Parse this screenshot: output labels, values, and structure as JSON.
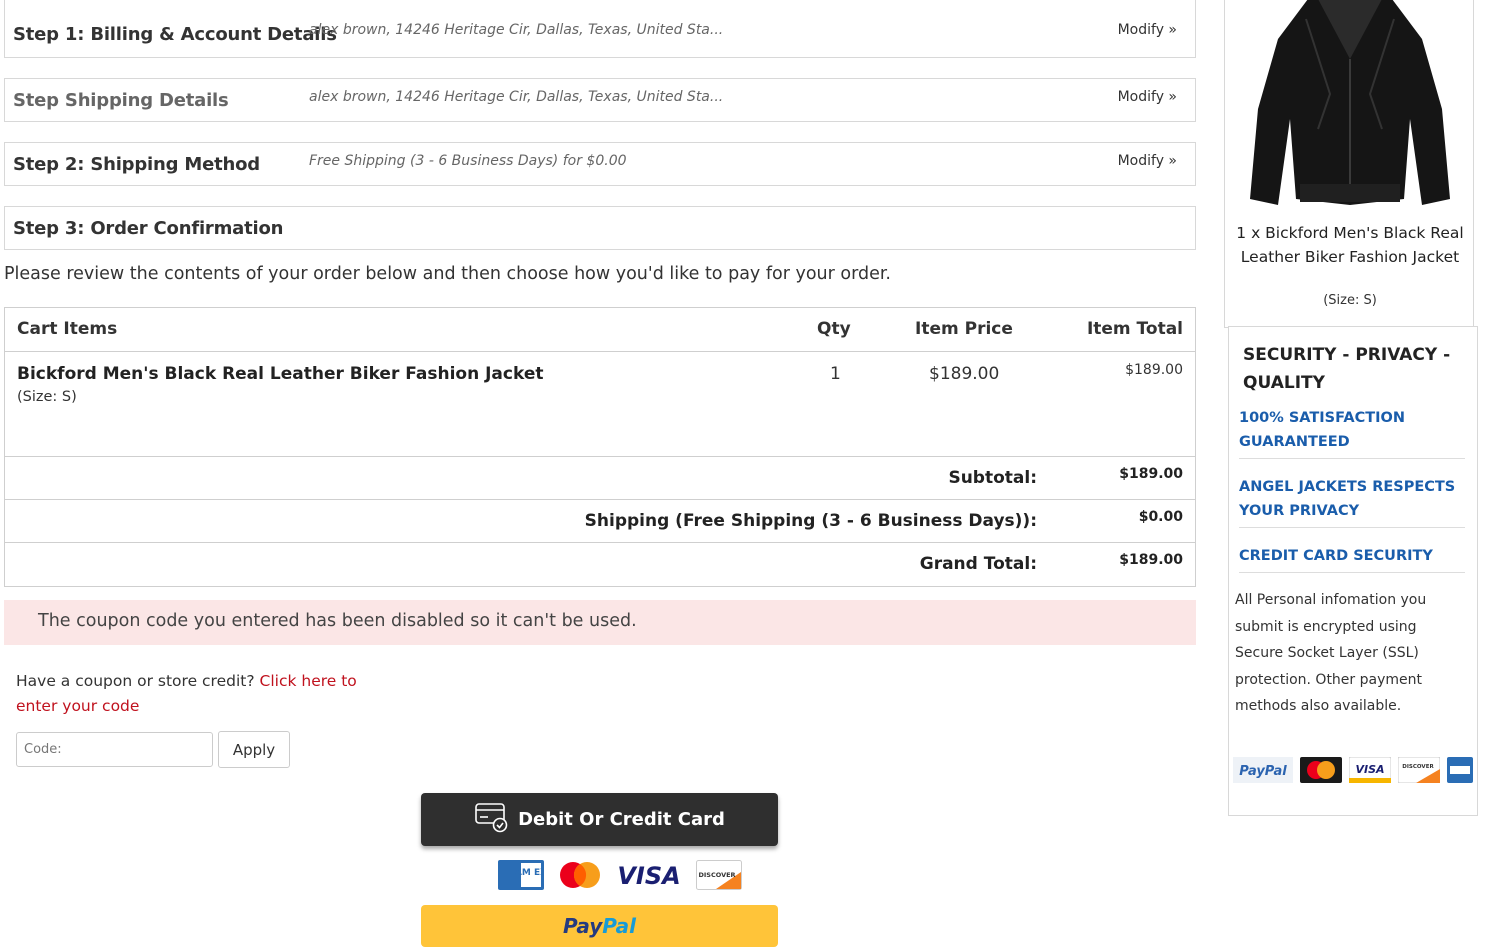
{
  "steps": [
    {
      "title": "Step 1: Billing & Account Details",
      "detail": "alex brown, 14246 Heritage Cir, Dallas, Texas, United Sta...",
      "modify": "Modify »"
    },
    {
      "title": "Step Shipping Details",
      "detail": "alex brown, 14246 Heritage Cir, Dallas, Texas, United Sta...",
      "modify": "Modify »"
    },
    {
      "title": "Step 2: Shipping Method",
      "detail": "Free Shipping (3 - 6 Business Days) for $0.00",
      "modify": "Modify »"
    },
    {
      "title": "Step 3: Order Confirmation"
    }
  ],
  "intro": "Please review the contents of your order below and then choose how you'd like to pay for your order.",
  "cart": {
    "headers": {
      "items": "Cart Items",
      "qty": "Qty",
      "price": "Item Price",
      "total": "Item Total"
    },
    "item": {
      "name": "Bickford Men's Black Real Leather Biker Fashion Jacket",
      "size": "(Size: S)",
      "qty": "1",
      "price": "$189.00",
      "total": "$189.00"
    },
    "subtotal": {
      "label": "Subtotal:",
      "value": "$189.00"
    },
    "shipping": {
      "label": "Shipping (Free Shipping (3 - 6 Business Days)):",
      "value": "$0.00"
    },
    "grand": {
      "label": "Grand Total:",
      "value": "$189.00"
    }
  },
  "alert": "The coupon code you entered has been disabled so it can't be used.",
  "coupon": {
    "prompt": "Have a coupon or store credit?",
    "link": "Click here to enter your code",
    "placeholder": "Code:",
    "apply": "Apply"
  },
  "payment": {
    "card_button": "Debit Or Credit Card",
    "paypal_a": "Pay",
    "paypal_b": "Pal",
    "card_logos": [
      "amex",
      "mastercard",
      "visa",
      "discover"
    ],
    "visa_text": "VISA",
    "amex_text": "AM EX",
    "discover_text": "DISCOVER"
  },
  "sidebar": {
    "product_caption": "1 x Bickford Men's Black Real Leather Biker Fashion Jacket",
    "product_size": "(Size: S)",
    "security_title": "SECURITY - PRIVACY - QUALITY",
    "links": [
      "100% SATISFACTION GUARANTEED",
      "ANGEL JACKETS RESPECTS YOUR PRIVACY",
      "CREDIT CARD SECURITY"
    ],
    "body": "All Personal infomation you submit is encrypted using Secure Socket Layer (SSL) protection. Other payment methods also available.",
    "logos": [
      "paypal",
      "mastercard",
      "visa",
      "discover",
      "amex"
    ],
    "logo_texts": {
      "paypal": "PayPal",
      "visa": "VISA",
      "discover": "DISCOVER"
    }
  },
  "colors": {
    "link_red": "#c0121e",
    "link_blue": "#1a5dab",
    "alert_bg": "#fbe6e6",
    "paypal_yellow": "#ffc439",
    "card_btn": "#2f2f2f"
  }
}
